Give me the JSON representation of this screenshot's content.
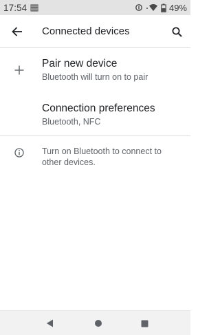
{
  "status_bar": {
    "time": "17:54",
    "battery": "49%",
    "icons": [
      "notification-icon",
      "data-saver-icon",
      "wifi-icon",
      "battery-icon"
    ]
  },
  "app_bar": {
    "title": "Connected devices",
    "back_icon": "arrow-back-icon",
    "search_icon": "search-icon"
  },
  "list": {
    "pair_new_device": {
      "icon": "plus-icon",
      "title": "Pair new device",
      "subtitle": "Bluetooth will turn on to pair"
    },
    "connection_preferences": {
      "title": "Connection preferences",
      "subtitle": "Bluetooth, NFC"
    },
    "info": {
      "icon": "info-icon",
      "text": "Turn on Bluetooth to connect to other devices."
    }
  },
  "nav_bar": {
    "buttons": [
      "back-triangle-icon",
      "home-circle-icon",
      "recents-square-icon"
    ]
  },
  "colors": {
    "status_bar_bg": "#e3e3e3",
    "primary_text": "#202124",
    "secondary_text": "#5f6368",
    "nav_bar_bg": "#f2f2f2"
  }
}
